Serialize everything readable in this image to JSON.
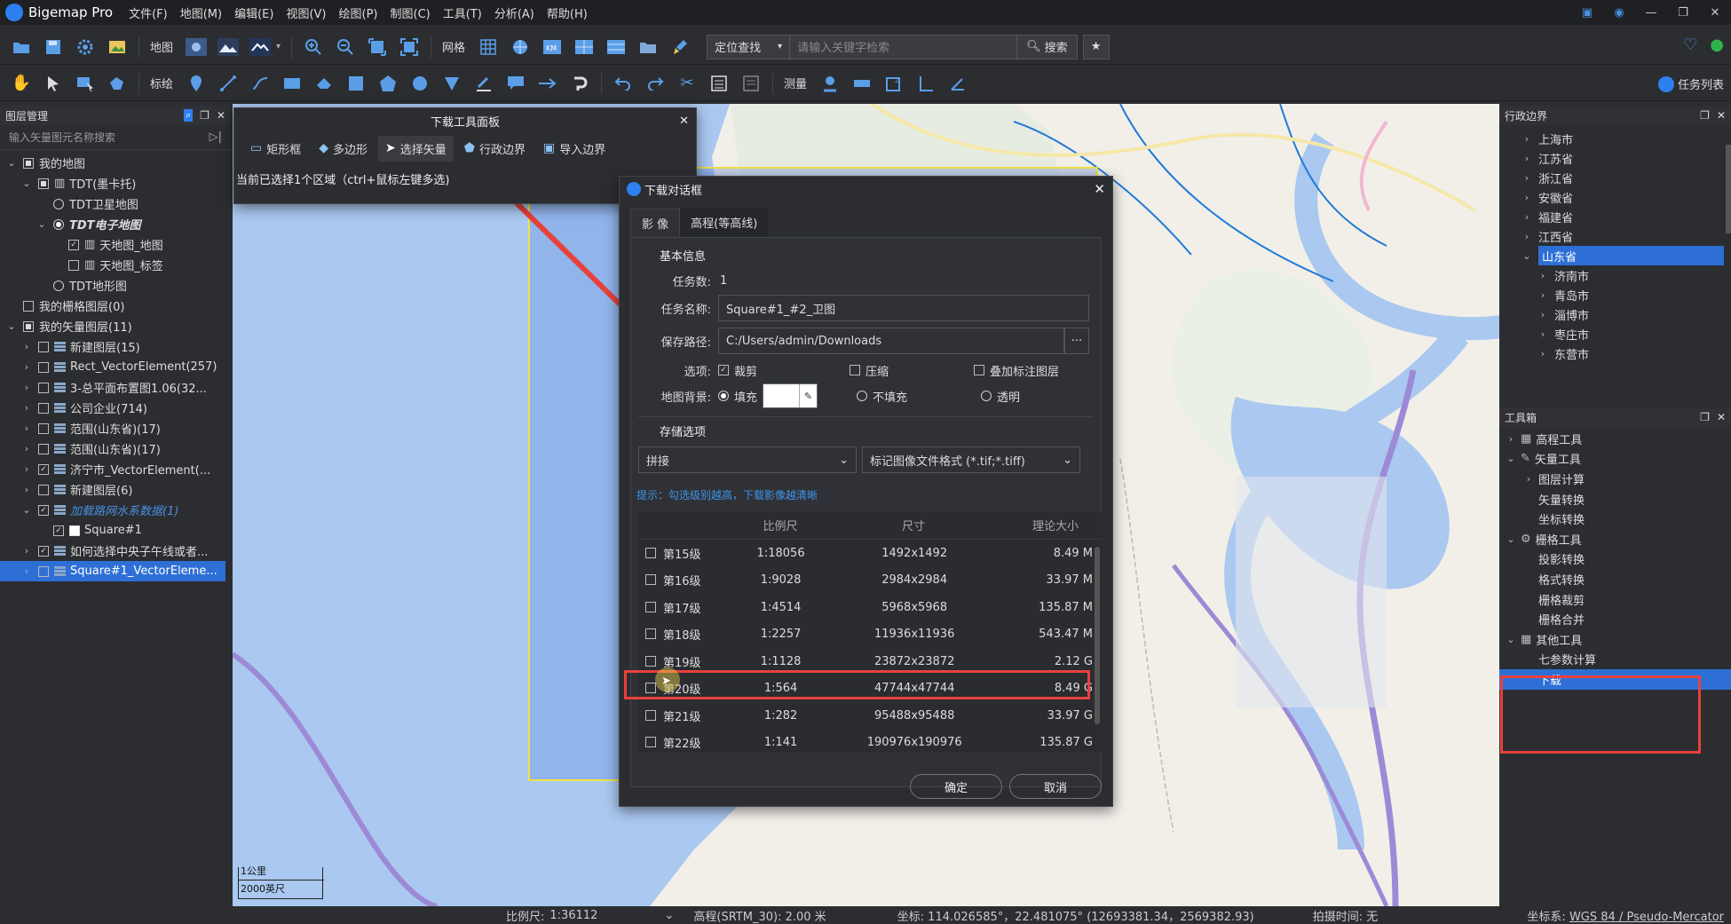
{
  "app": {
    "title": "Bigemap Pro",
    "menus": [
      "文件(F)",
      "地图(M)",
      "编辑(E)",
      "视图(V)",
      "绘图(P)",
      "制图(C)",
      "工具(T)",
      "分析(A)",
      "帮助(H)"
    ]
  },
  "toolbar": {
    "map_label": "地图",
    "grid_label": "网格",
    "search_mode": "定位查找",
    "search_placeholder": "请输入关键字检索",
    "search_button": "搜索",
    "annotate_label": "标绘",
    "measure_label": "测量",
    "task_list": "任务列表"
  },
  "layers": {
    "title": "图层管理",
    "filter_placeholder": "输入矢量图元名称搜索",
    "items": [
      {
        "label": "我的地图",
        "depth": 0,
        "chev": "v",
        "ctrl": "sq",
        "icon": ""
      },
      {
        "label": "TDT(墨卡托)",
        "depth": 1,
        "chev": "v",
        "ctrl": "sq",
        "icon": "map"
      },
      {
        "label": "TDT卫星地图",
        "depth": 2,
        "chev": "",
        "ctrl": "rad",
        "icon": ""
      },
      {
        "label": "TDT电子地图",
        "depth": 2,
        "chev": "v",
        "ctrl": "radon",
        "icon": "",
        "style": "bi"
      },
      {
        "label": "天地图_地图",
        "depth": 3,
        "chev": "",
        "ctrl": "chk",
        "icon": "map"
      },
      {
        "label": "天地图_标签",
        "depth": 3,
        "chev": "",
        "ctrl": "cb",
        "icon": "map"
      },
      {
        "label": "TDT地形图",
        "depth": 2,
        "chev": "",
        "ctrl": "rad",
        "icon": ""
      },
      {
        "label": "我的栅格图层(0)",
        "depth": 0,
        "chev": "",
        "ctrl": "cb",
        "icon": ""
      },
      {
        "label": "我的矢量图层(11)",
        "depth": 0,
        "chev": "v",
        "ctrl": "sq",
        "icon": ""
      },
      {
        "label": "新建图层(15)",
        "depth": 1,
        "chev": ">",
        "ctrl": "cb",
        "icon": "layer"
      },
      {
        "label": "Rect_VectorElement(257)",
        "depth": 1,
        "chev": ">",
        "ctrl": "cb",
        "icon": "layer"
      },
      {
        "label": "3-总平面布置图1.06(32...",
        "depth": 1,
        "chev": ">",
        "ctrl": "cb",
        "icon": "layer"
      },
      {
        "label": "公司企业(714)",
        "depth": 1,
        "chev": ">",
        "ctrl": "cb",
        "icon": "layer"
      },
      {
        "label": "范围(山东省)(17)",
        "depth": 1,
        "chev": ">",
        "ctrl": "cb",
        "icon": "layer"
      },
      {
        "label": "范围(山东省)(17)",
        "depth": 1,
        "chev": ">",
        "ctrl": "cb",
        "icon": "layer"
      },
      {
        "label": "济宁市_VectorElement(...",
        "depth": 1,
        "chev": ">",
        "ctrl": "chk",
        "icon": "layer"
      },
      {
        "label": "新建图层(6)",
        "depth": 1,
        "chev": ">",
        "ctrl": "cb",
        "icon": "layer"
      },
      {
        "label": "加载路网水系数据(1)",
        "depth": 1,
        "chev": "v",
        "ctrl": "chk",
        "icon": "layer",
        "style": "blue"
      },
      {
        "label": "Square#1",
        "depth": 2,
        "chev": "",
        "ctrl": "chk",
        "icon": "square"
      },
      {
        "label": "如何选择中央子午线或者...",
        "depth": 1,
        "chev": ">",
        "ctrl": "chk",
        "icon": "layer"
      },
      {
        "label": "Square#1_VectorEleme...",
        "depth": 1,
        "chev": ">",
        "ctrl": "cb",
        "icon": "layer",
        "style": "sel"
      }
    ]
  },
  "admin": {
    "title": "行政边界",
    "items": [
      {
        "label": "上海市",
        "depth": 1
      },
      {
        "label": "江苏省",
        "depth": 1
      },
      {
        "label": "浙江省",
        "depth": 1
      },
      {
        "label": "安徽省",
        "depth": 1
      },
      {
        "label": "福建省",
        "depth": 1
      },
      {
        "label": "江西省",
        "depth": 1
      },
      {
        "label": "山东省",
        "depth": 1,
        "open": true,
        "selected": true
      },
      {
        "label": "济南市",
        "depth": 2
      },
      {
        "label": "青岛市",
        "depth": 2
      },
      {
        "label": "淄博市",
        "depth": 2
      },
      {
        "label": "枣庄市",
        "depth": 2
      },
      {
        "label": "东营市",
        "depth": 2
      }
    ]
  },
  "toolbox": {
    "title": "工具箱",
    "items": [
      {
        "label": "高程工具",
        "depth": 0,
        "chev": ">",
        "icon": "▦"
      },
      {
        "label": "矢量工具",
        "depth": 0,
        "chev": "v",
        "icon": "✎"
      },
      {
        "label": "图层计算",
        "depth": 1,
        "chev": ">",
        "icon": ""
      },
      {
        "label": "矢量转换",
        "depth": 1,
        "chev": "",
        "icon": ""
      },
      {
        "label": "坐标转换",
        "depth": 1,
        "chev": "",
        "icon": ""
      },
      {
        "label": "栅格工具",
        "depth": 0,
        "chev": "v",
        "icon": "⚙"
      },
      {
        "label": "投影转换",
        "depth": 1,
        "chev": "",
        "icon": ""
      },
      {
        "label": "格式转换",
        "depth": 1,
        "chev": "",
        "icon": ""
      },
      {
        "label": "栅格裁剪",
        "depth": 1,
        "chev": "",
        "icon": ""
      },
      {
        "label": "栅格合并",
        "depth": 1,
        "chev": "",
        "icon": ""
      },
      {
        "label": "其他工具",
        "depth": 0,
        "chev": "v",
        "icon": "▦"
      },
      {
        "label": "七参数计算",
        "depth": 1,
        "chev": "",
        "icon": ""
      },
      {
        "label": "下载",
        "depth": 1,
        "chev": "",
        "icon": "",
        "selected": true
      }
    ]
  },
  "dlpanel": {
    "title": "下载工具面板",
    "buttons": [
      "矩形框",
      "多边形",
      "选择矢量",
      "行政边界",
      "导入边界"
    ],
    "hint": "当前已选择1个区域（ctrl+鼠标左键多选)"
  },
  "dialog": {
    "title": "下载对话框",
    "tabs": [
      "影 像",
      "高程(等高线)"
    ],
    "basic_title": "基本信息",
    "task_count_label": "任务数:",
    "task_count": "1",
    "task_name_label": "任务名称:",
    "task_name": "Square#1_#2_卫图",
    "save_path_label": "保存路径:",
    "save_path": "C:/Users/admin/Downloads",
    "browse": "···",
    "options_label": "选项:",
    "opt_crop": "裁剪",
    "opt_compress": "压缩",
    "opt_overlay": "叠加标注图层",
    "bg_label": "地图背景:",
    "bg_fill": "填充",
    "bg_nofill": "不填充",
    "bg_transparent": "透明",
    "storage_title": "存储选项",
    "storage_mode": "拼接",
    "storage_format": "标记图像文件格式 (*.tif;*.tiff)",
    "tip": "提示：勾选级别越高，下载影像越清晰",
    "columns": [
      "比例尺",
      "尺寸",
      "理论大小"
    ],
    "rows": [
      {
        "level": "第15级",
        "scale": "1:18056",
        "size": "1492x1492",
        "bytes": "8.49 M"
      },
      {
        "level": "第16级",
        "scale": "1:9028",
        "size": "2984x2984",
        "bytes": "33.97 M"
      },
      {
        "level": "第17级",
        "scale": "1:4514",
        "size": "5968x5968",
        "bytes": "135.87 M"
      },
      {
        "level": "第18级",
        "scale": "1:2257",
        "size": "11936x11936",
        "bytes": "543.47 M"
      },
      {
        "level": "第19级",
        "scale": "1:1128",
        "size": "23872x23872",
        "bytes": "2.12 G"
      },
      {
        "level": "第20级",
        "scale": "1:564",
        "size": "47744x47744",
        "bytes": "8.49 G"
      },
      {
        "level": "第21级",
        "scale": "1:282",
        "size": "95488x95488",
        "bytes": "33.97 G"
      },
      {
        "level": "第22级",
        "scale": "1:141",
        "size": "190976x190976",
        "bytes": "135.87 G"
      }
    ],
    "ok": "确定",
    "cancel": "取消"
  },
  "map": {
    "scale_km": "1公里",
    "scale_ft": "2000英尺"
  },
  "status": {
    "scale_label": "比例尺:",
    "scale_value": "1:36112",
    "elev": "高程(SRTM_30): 2.00 米",
    "coord": "坐标: 114.026585°，22.481075° (12693381.34，2569382.93)",
    "shoot": "拍摄时间: 无",
    "crs_label": "坐标系:",
    "crs_value": "WGS 84 / Pseudo-Mercator"
  },
  "colors": {
    "accent": "#2e7ff0",
    "highlight": "#e8413c",
    "selected": "#2e6fd6"
  }
}
